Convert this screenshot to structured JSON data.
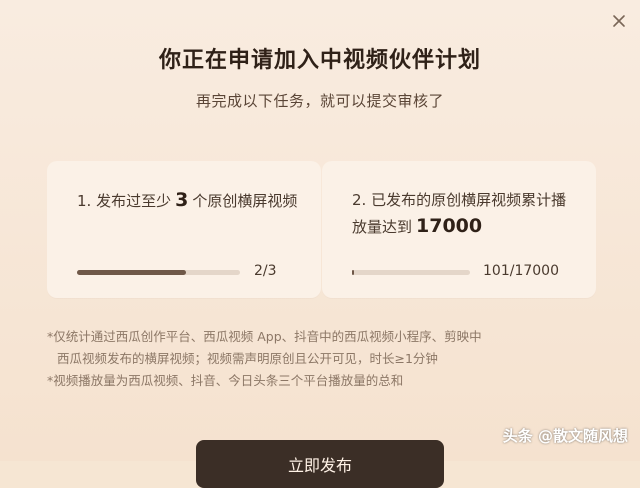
{
  "dialog": {
    "title": "你正在申请加入中视频伙伴计划",
    "subtitle": "再完成以下任务，就可以提交审核了"
  },
  "tasks": [
    {
      "prefix": "1. 发布过至少",
      "number": "3",
      "suffix": "个原创横屏视频",
      "progress_text": "2/3",
      "progress_fraction": 0.667
    },
    {
      "prefix": "2. 已发布的原创横屏视频累计播放量达到",
      "number": "17000",
      "suffix": "",
      "progress_text": "101/17000",
      "progress_fraction": 0.006
    }
  ],
  "notes": {
    "line1": "*仅统计通过西瓜创作平台、西瓜视频 App、抖音中的西瓜视频小程序、剪映中",
    "line2": "西瓜视频发布的横屏视频；视频需声明原创且公开可见，时长≥1分钟",
    "line3": "*视频播放量为西瓜视频、抖音、今日头条三个平台播放量的总和"
  },
  "submit_label": "立即发布",
  "watermark": "头条 @散文随风想",
  "colors": {
    "background": "#f6e6d3",
    "card": "#fbf1e7",
    "progress_fill": "#6f5848",
    "progress_track": "#e4d6c9",
    "button": "#3b2e26"
  }
}
